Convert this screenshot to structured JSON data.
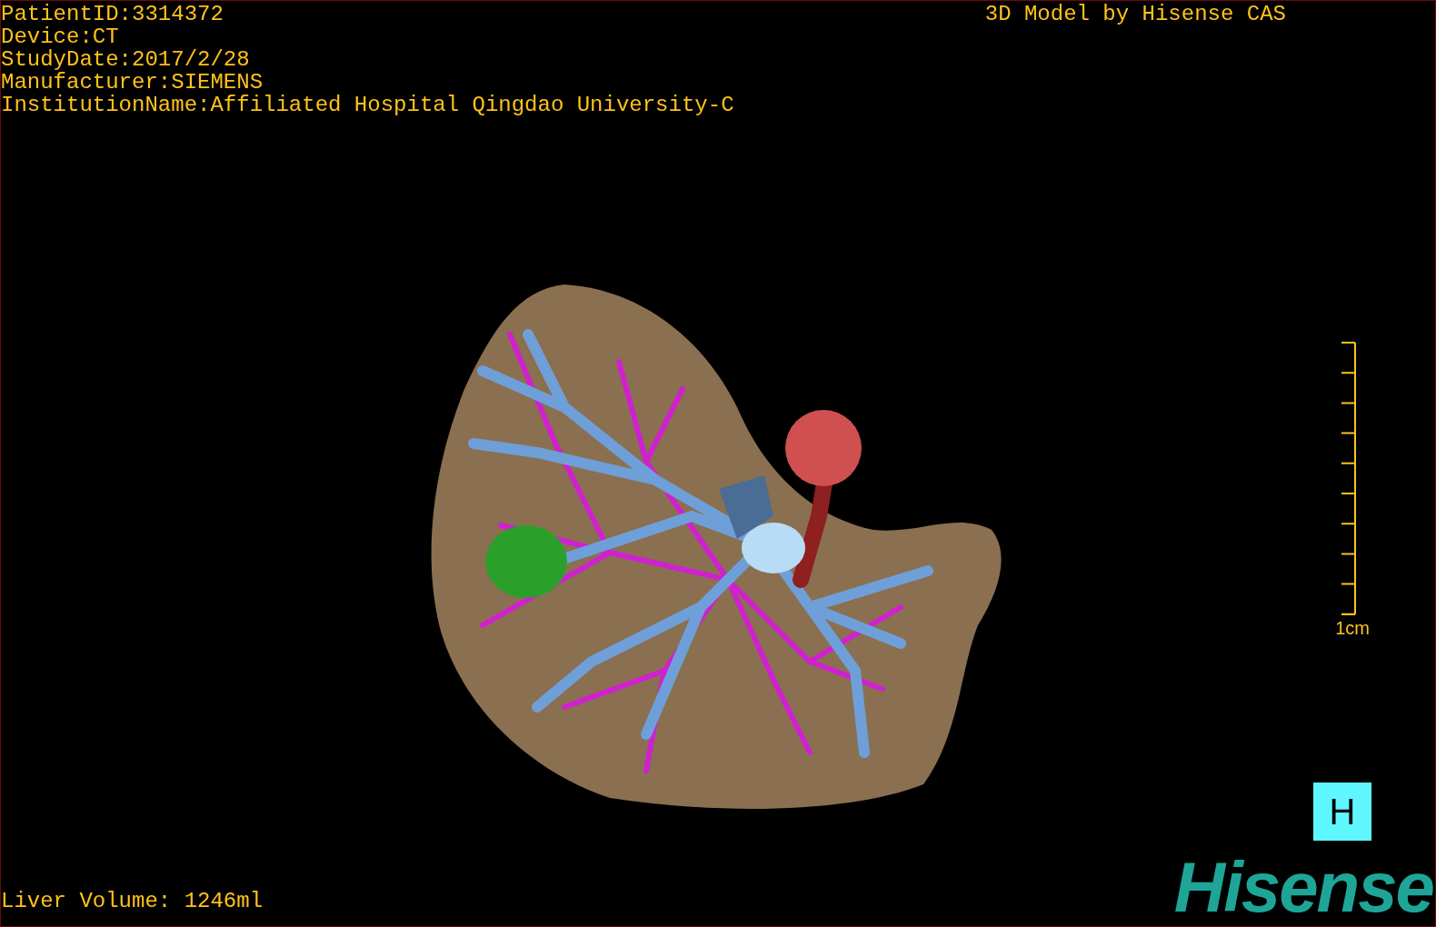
{
  "info_lines": [
    "PatientID:3314372",
    "Device:CT",
    "StudyDate:2017/2/28",
    "Manufacturer:SIEMENS",
    "InstitutionName:Affiliated Hospital Qingdao University-C"
  ],
  "title": "3D Model by Hisense CAS",
  "scale_bar": {
    "label": "1cm"
  },
  "orientation_marker": "H",
  "liver_volume": "Liver Volume: 1246ml",
  "logo": "Hisense"
}
